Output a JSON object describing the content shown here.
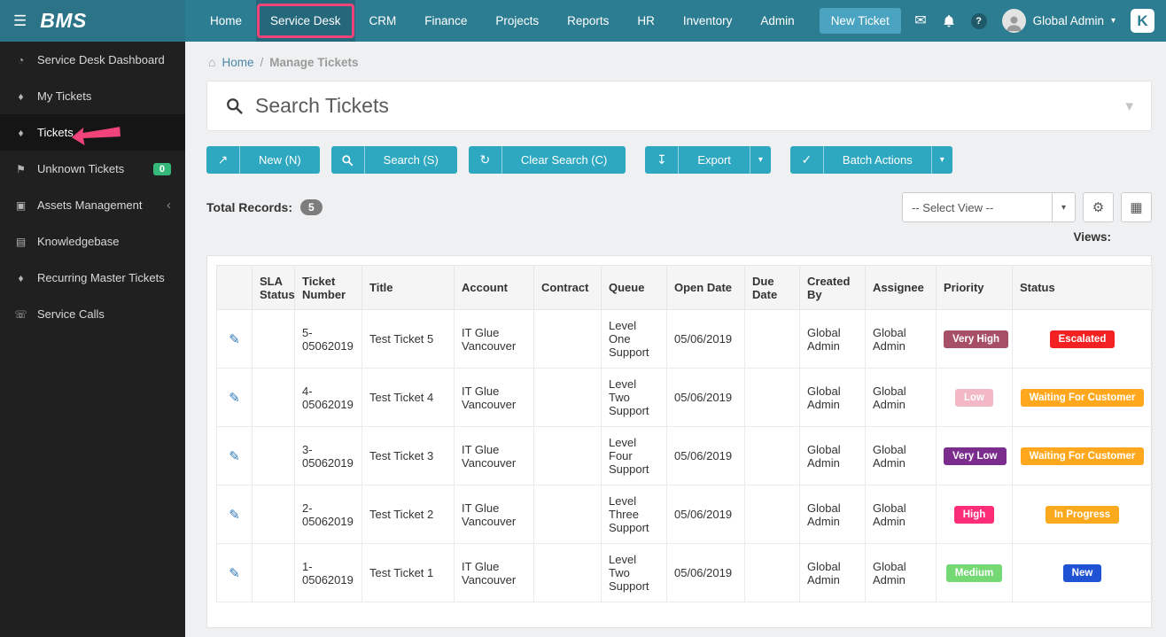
{
  "navbar": {
    "brand": "BMS",
    "items": [
      {
        "label": "Home"
      },
      {
        "label": "Service Desk",
        "active": true,
        "annotated": true
      },
      {
        "label": "CRM"
      },
      {
        "label": "Finance"
      },
      {
        "label": "Projects"
      },
      {
        "label": "Reports"
      },
      {
        "label": "HR"
      },
      {
        "label": "Inventory"
      },
      {
        "label": "Admin"
      }
    ],
    "new_ticket_label": "New Ticket",
    "user_name": "Global Admin",
    "kaseya": "K"
  },
  "sidebar": {
    "items": [
      {
        "label": "Service Desk Dashboard",
        "icon": "dashboard-icon"
      },
      {
        "label": "My Tickets",
        "icon": "ticket-icon"
      },
      {
        "label": "Tickets",
        "icon": "ticket-icon",
        "active": true
      },
      {
        "label": "Unknown Tickets",
        "icon": "flag-icon",
        "badge": "0"
      },
      {
        "label": "Assets Management",
        "icon": "assets-icon",
        "chevron": true
      },
      {
        "label": "Knowledgebase",
        "icon": "book-icon"
      },
      {
        "label": "Recurring Master Tickets",
        "icon": "ticket-icon"
      },
      {
        "label": "Service Calls",
        "icon": "phone-icon"
      }
    ]
  },
  "breadcrumb": {
    "home": "Home",
    "separator": "/",
    "current": "Manage Tickets"
  },
  "search_panel": {
    "title": "Search Tickets"
  },
  "toolbar": {
    "new_label": "New (N)",
    "search_label": "Search (S)",
    "clear_label": "Clear Search (C)",
    "export_label": "Export",
    "batch_label": "Batch Actions"
  },
  "records": {
    "total_label": "Total Records:",
    "count": "5"
  },
  "view_controls": {
    "select_view": "-- Select View --",
    "views_label": "Views:"
  },
  "table": {
    "headers": [
      "",
      "SLA Status",
      "Ticket Number",
      "Title",
      "Account",
      "Contract",
      "Queue",
      "Open Date",
      "Due Date",
      "Created By",
      "Assignee",
      "Priority",
      "Status"
    ],
    "rows": [
      {
        "sla_status": "",
        "ticket_number": "5-05062019",
        "title": "Test Ticket 5",
        "account": "IT Glue Vancouver",
        "contract": "",
        "queue": "Level One Support",
        "open_date": "05/06/2019",
        "due_date": "",
        "created_by": "Global Admin",
        "assignee": "Global Admin",
        "priority": "Very High",
        "priority_color": "#a84f68",
        "status": "Escalated",
        "status_color": "#f32121"
      },
      {
        "sla_status": "",
        "ticket_number": "4-05062019",
        "title": "Test Ticket 4",
        "account": "IT Glue Vancouver",
        "contract": "",
        "queue": "Level Two Support",
        "open_date": "05/06/2019",
        "due_date": "",
        "created_by": "Global Admin",
        "assignee": "Global Admin",
        "priority": "Low",
        "priority_color": "#f2b8c6",
        "status": "Waiting For Customer",
        "status_color": "#ffa81e"
      },
      {
        "sla_status": "",
        "ticket_number": "3-05062019",
        "title": "Test Ticket 3",
        "account": "IT Glue Vancouver",
        "contract": "",
        "queue": "Level Four Support",
        "open_date": "05/06/2019",
        "due_date": "",
        "created_by": "Global Admin",
        "assignee": "Global Admin",
        "priority": "Very Low",
        "priority_color": "#7b2d8e",
        "status": "Waiting For Customer",
        "status_color": "#ffa81e"
      },
      {
        "sla_status": "",
        "ticket_number": "2-05062019",
        "title": "Test Ticket 2",
        "account": "IT Glue Vancouver",
        "contract": "",
        "queue": "Level Three Support",
        "open_date": "05/06/2019",
        "due_date": "",
        "created_by": "Global Admin",
        "assignee": "Global Admin",
        "priority": "High",
        "priority_color": "#fd2e77",
        "status": "In Progress",
        "status_color": "#fbaa1d"
      },
      {
        "sla_status": "",
        "ticket_number": "1-05062019",
        "title": "Test Ticket 1",
        "account": "IT Glue Vancouver",
        "contract": "",
        "queue": "Level Two Support",
        "open_date": "05/06/2019",
        "due_date": "",
        "created_by": "Global Admin",
        "assignee": "Global Admin",
        "priority": "Medium",
        "priority_color": "#74d874",
        "status": "New",
        "status_color": "#2053d4"
      }
    ]
  },
  "icons": {
    "hamburger": "☰",
    "mail": "✉",
    "help": "?",
    "dropdown_caret": "▾",
    "panel_chevron": "▾",
    "chevron_collapsed": "‹",
    "breadcrumb_home": "⌂",
    "edit": "✎",
    "gear": "⚙",
    "columns": "▦",
    "new_external": "↗",
    "refresh": "↻",
    "download": "↧",
    "check": "✓"
  },
  "colors": {
    "navbar_teal": "#2d7d92",
    "button_teal": "#2ea7c0",
    "annotation_pink": "#f0437a",
    "sidebar_badge_green": "#35b87a",
    "link_blue": "#337ab7"
  }
}
